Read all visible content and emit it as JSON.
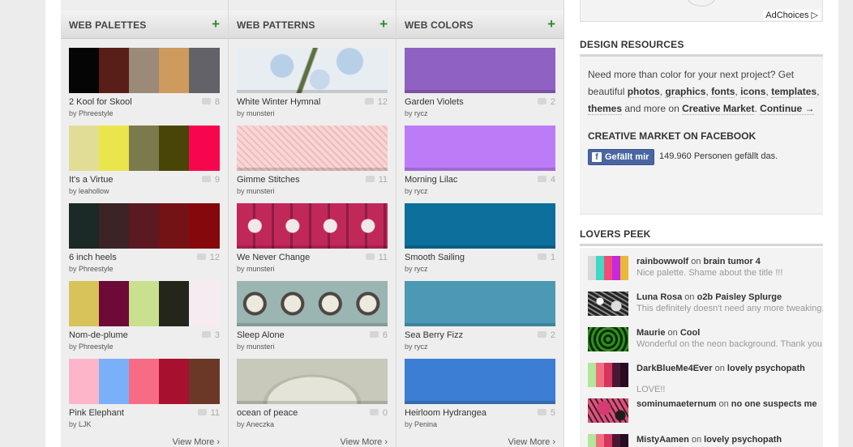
{
  "columns": [
    {
      "title": "WEB PALETTES",
      "plus": "+",
      "view_more": "View More ›",
      "items": [
        {
          "title": "2 Kool for Skool",
          "by": "by",
          "author": "Phreestyle",
          "count": "8",
          "colors": [
            "#050505",
            "#5a1e18",
            "#9b8a78",
            "#cf9a5e",
            "#636269"
          ],
          "widths": [
            37,
            37,
            37,
            37,
            38
          ]
        },
        {
          "title": "It's a Virtue",
          "by": "by",
          "author": "leahollow",
          "count": "9",
          "colors": [
            "#e2dd96",
            "#e9e54a",
            "#7b7a4c",
            "#484507",
            "#f7064e"
          ],
          "widths": [
            37,
            37,
            37,
            37,
            38
          ]
        },
        {
          "title": "6 inch heels",
          "by": "by",
          "author": "Phreestyle",
          "count": "12",
          "colors": [
            "#1b2927",
            "#3c2325",
            "#5b1a20",
            "#751216",
            "#85090c"
          ],
          "widths": [
            37,
            37,
            37,
            37,
            38
          ]
        },
        {
          "title": "Nom-de-plume",
          "by": "by",
          "author": "Phreestyle",
          "count": "3",
          "colors": [
            "#d8c25a",
            "#6d0a38",
            "#c9e08f",
            "#24261c",
            "#f5ebf0"
          ],
          "widths": [
            37,
            37,
            37,
            37,
            38
          ]
        },
        {
          "title": "Pink Elephant",
          "by": "by",
          "author": "LJK",
          "count": "11",
          "colors": [
            "#fcb5c9",
            "#7ab0f7",
            "#f86b85",
            "#a8102f",
            "#6b3828"
          ],
          "widths": [
            37,
            37,
            37,
            37,
            38
          ]
        }
      ]
    },
    {
      "title": "WEB PATTERNS",
      "plus": "+",
      "view_more": "View More ›",
      "items": [
        {
          "title": "White Winter Hymnal",
          "by": "by",
          "author": "munsteri",
          "count": "12",
          "pattern": "p-winter"
        },
        {
          "title": "Gimme Stitches",
          "by": "by",
          "author": "munsteri",
          "count": "11",
          "pattern": "p-stitch"
        },
        {
          "title": "We Never Change",
          "by": "by",
          "author": "munsteri",
          "count": "11",
          "pattern": "p-never"
        },
        {
          "title": "Sleep Alone",
          "by": "by",
          "author": "munsteri",
          "count": "6",
          "pattern": "p-sleep"
        },
        {
          "title": "ocean of peace",
          "by": "by",
          "author": "Aneczka",
          "count": "0",
          "pattern": "p-ocean"
        }
      ]
    },
    {
      "title": "WEB COLORS",
      "plus": "+",
      "view_more": "View More ›",
      "items": [
        {
          "title": "Garden Violets",
          "by": "by",
          "author": "rycz",
          "count": "2",
          "color": "#8f62c2"
        },
        {
          "title": "Morning Lilac",
          "by": "by",
          "author": "rycz",
          "count": "4",
          "color": "#bd7cf7"
        },
        {
          "title": "Smooth Sailing",
          "by": "by",
          "author": "rycz",
          "count": "1",
          "color": "#0d6f9b"
        },
        {
          "title": "Sea Berry Fizz",
          "by": "by",
          "author": "rycz",
          "count": "2",
          "color": "#4b99b5"
        },
        {
          "title": "Heirloom Hydrangea",
          "by": "by",
          "author": "Penina",
          "count": "5",
          "color": "#3c7ed3"
        }
      ]
    }
  ],
  "ad": {
    "label": "AdChoices ▷"
  },
  "design_resources": {
    "title": "DESIGN RESOURCES",
    "intro": "Need more than color for your next project? Get beautiful",
    "links": [
      "photos",
      "graphics",
      "fonts",
      "icons",
      "templates",
      "themes"
    ],
    "sep": ",",
    "and_more": "and more on",
    "market": "Creative Market",
    "continue": "Continue →",
    "fb_title": "CREATIVE MARKET ON FACEBOOK",
    "fb_button": "Gefällt mir",
    "fb_icon": "f",
    "fb_count": "149.960 Personen gefällt das."
  },
  "lovers_peek": {
    "title": "LOVERS PEEK",
    "on": "on",
    "items": [
      {
        "user": "rainbowwolf",
        "target": "brain tumor 4",
        "message": "Nice palette. Shame about the title !!!",
        "thumb_colors": [
          "#d9d9d9",
          "#3fd9c4",
          "#f24b7a",
          "#c42adb",
          "#e8b83a"
        ]
      },
      {
        "user": "Luna Rosa",
        "target": "o2b Paisley Splurge",
        "message": "This definitely doesn't need any more tweaking,",
        "thumb_pattern": "t-luna"
      },
      {
        "user": "Maurie",
        "target": "Cool",
        "message": "Wonderful on the neon background. Thank you",
        "thumb_pattern": "t-cool"
      },
      {
        "user": "DarkBlueMe4Ever",
        "target": "lovely psychopath",
        "message": "LOVE!!",
        "thumb_colors": [
          "#b4e59a",
          "#f26f82",
          "#d7345e",
          "#4a1832",
          "#2a0b22"
        ]
      },
      {
        "user": "sominumaeternum",
        "target": "no one suspects me",
        "message": "",
        "thumb_pattern": "t-psycho"
      },
      {
        "user": "MistyAamen",
        "target": "lovely psychopath",
        "message": "",
        "thumb_colors": [
          "#b4e59a",
          "#f26f82",
          "#d7345e",
          "#4a1832",
          "#2a0b22"
        ]
      }
    ]
  }
}
